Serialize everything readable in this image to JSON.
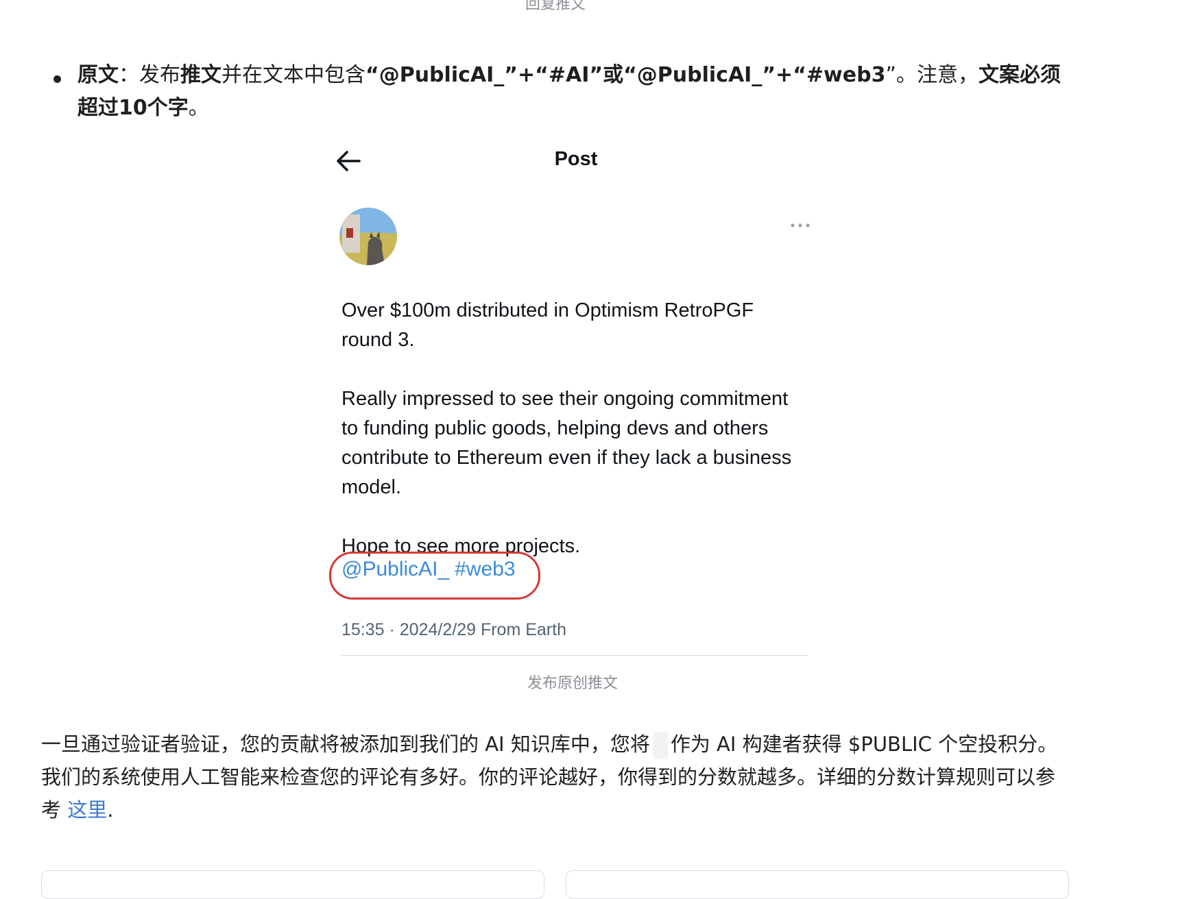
{
  "top_caption": "回复推文",
  "bullet": {
    "label": "原文",
    "sep": "：发布",
    "bold1": "推文",
    "text1": "并在文本中包含",
    "bold2": "“@PublicAI_”+“#AI”或“@PublicAI_”+“#web3",
    "text2": "”。注意，",
    "bold3": "文案必须超过10个字",
    "text3": "。"
  },
  "post": {
    "title": "Post",
    "paragraphs": [
      "Over $100m distributed in Optimism RetroPGF round 3.",
      "Really impressed to see their ongoing commitment to funding public goods, helping devs and others contribute to Ethereum even if they lack a business model.",
      "Hope to see more projects."
    ],
    "mention": "@PublicAI_",
    "hashtag": "#web3",
    "timestamp": "15:35 · 2024/2/29 From Earth"
  },
  "caption_2": "发布原创推文",
  "paragraph": {
    "text1": "一旦通过验证者验证，您的贡献将被添加到我们的 AI 知识库中，您将",
    "text2": "作为 AI 构建者获得 $PUBLIC 个空投积分。我们的系统使用人工智能来检查您的评论有多好。你的评论越好，你得到的分数就越多。详细的分数计算规则可以参考 ",
    "link": "这里",
    "text3": "."
  },
  "colors": {
    "link": "#3a8ad8",
    "highlight_ring": "#d23a33",
    "muted": "#8b8f96"
  },
  "icons": [
    "arrow-left-icon",
    "more-horizontal-icon"
  ]
}
